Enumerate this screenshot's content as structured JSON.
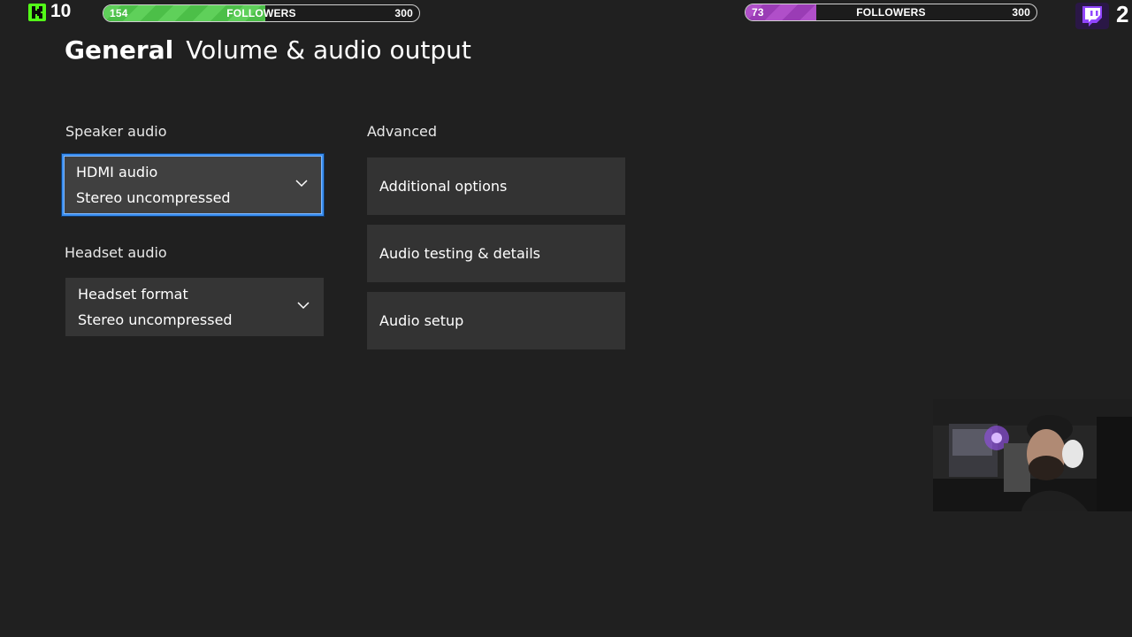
{
  "overlay": {
    "kick": {
      "count": "10",
      "goal_current": "154",
      "goal_label": "FOLLOWERS",
      "goal_max": "300",
      "progress": 0.513,
      "color": "#53fc18"
    },
    "twitch": {
      "count": "2",
      "goal_current": "73",
      "goal_label": "FOLLOWERS",
      "goal_max": "300",
      "progress": 0.243,
      "color": "#9146ff"
    }
  },
  "header": {
    "section": "General",
    "subsection": "Volume & audio output"
  },
  "speaker": {
    "label": "Speaker audio",
    "value": "HDMI audio",
    "format": "Stereo uncompressed"
  },
  "headset": {
    "label": "Headset audio",
    "value": "Headset format",
    "format": "Stereo uncompressed"
  },
  "advanced": {
    "label": "Advanced",
    "items": [
      {
        "label": "Additional options"
      },
      {
        "label": "Audio testing & details"
      },
      {
        "label": "Audio setup"
      }
    ]
  },
  "colors": {
    "background": "#202020",
    "tile": "#333333",
    "focus": "#3a8ef0"
  }
}
